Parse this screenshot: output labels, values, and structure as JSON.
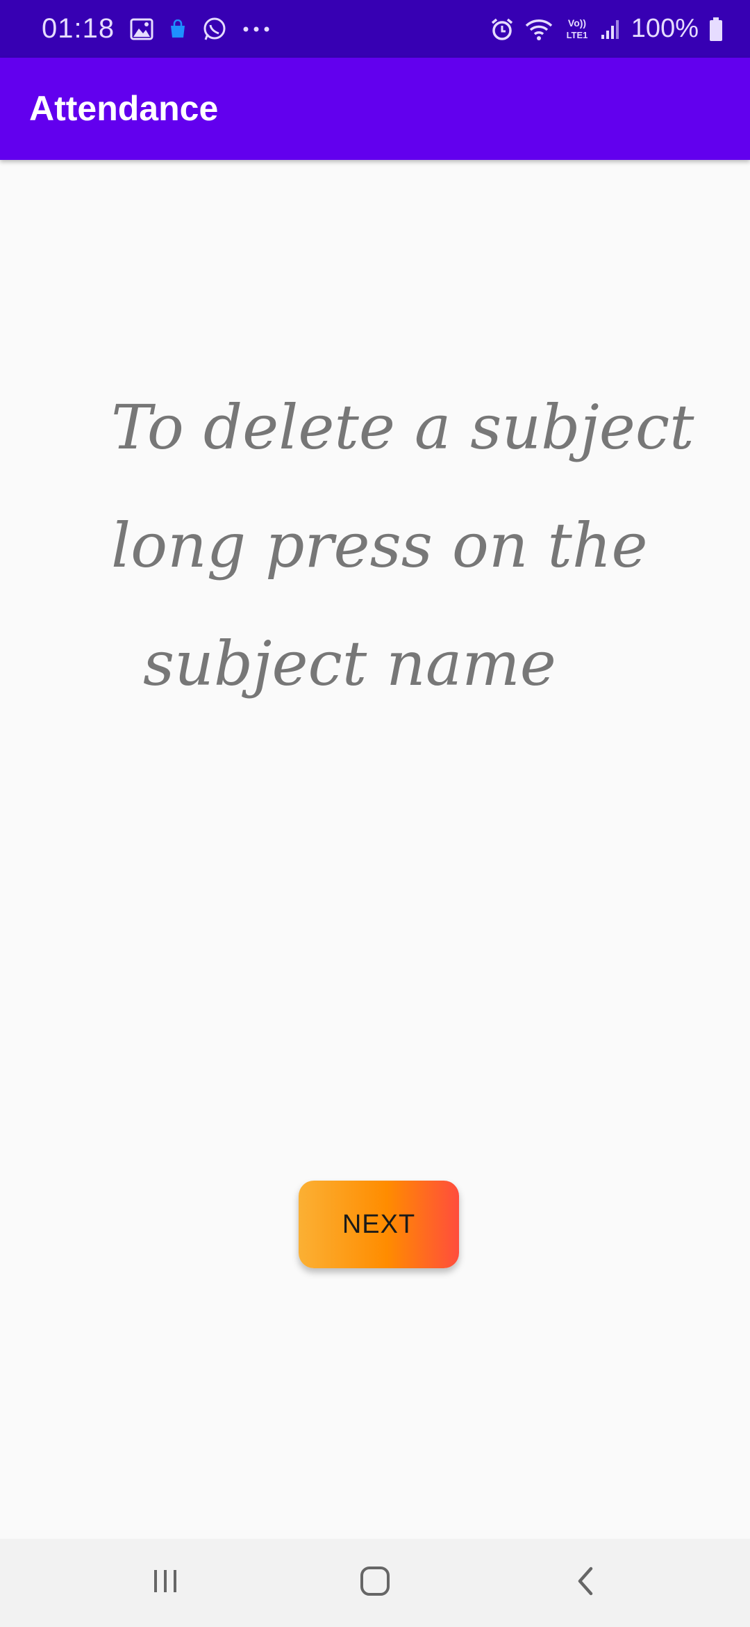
{
  "status_bar": {
    "time": "01:18",
    "icons_left": [
      "gallery-icon",
      "shopping-bag-icon",
      "whatsapp-icon",
      "more-dots-icon"
    ],
    "icons_right": [
      "alarm-icon",
      "wifi-icon",
      "volte-lte-icon",
      "signal-icon",
      "battery-icon"
    ],
    "volte_text": "Vo)) LTE1",
    "battery_percent": "100%"
  },
  "app_bar": {
    "title": "Attendance",
    "color": "#6200ee"
  },
  "main": {
    "hint_lines": [
      "To delete a subject",
      "long press on the",
      "subject name"
    ],
    "next_label": "NEXT"
  },
  "nav_bar": {
    "buttons": [
      "recent-apps",
      "home",
      "back"
    ]
  },
  "colors": {
    "status_bar": "#3700b3",
    "background": "#fafafa",
    "button_gradient_start": "#fbb034",
    "button_gradient_end": "#ff4d3d"
  }
}
